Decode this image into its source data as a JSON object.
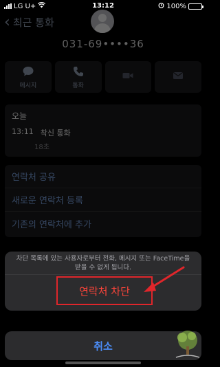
{
  "status_bar": {
    "carrier": "LG U+",
    "time": "13:12",
    "battery": "100%",
    "battery_level": 1.0
  },
  "header": {
    "back_label": "최근 통화",
    "phone_number": "031-69••••36"
  },
  "actions": [
    {
      "label": "메시지",
      "icon": "message-icon"
    },
    {
      "label": "통화",
      "icon": "phone-icon"
    },
    {
      "label": "",
      "icon": "video-icon"
    },
    {
      "label": "",
      "icon": "mail-icon"
    }
  ],
  "recent": {
    "title": "오늘",
    "time": "13:11",
    "type": "착신 통화",
    "duration": "18초"
  },
  "menu": {
    "share_contact": "연락처 공유",
    "new_contact": "새로운 연락처 등록",
    "add_to_existing": "기존의 연락처에 추가"
  },
  "sheet": {
    "message": "차단 목록에 있는 사용자로부터 전화, 메시지 또는 FaceTime을 받을 수 없게 됩니다.",
    "block_label": "연락처 차단",
    "cancel_label": "취소"
  },
  "colors": {
    "destructive": "#ff453a",
    "highlight": "#e0262b",
    "link": "#4b8df8"
  }
}
